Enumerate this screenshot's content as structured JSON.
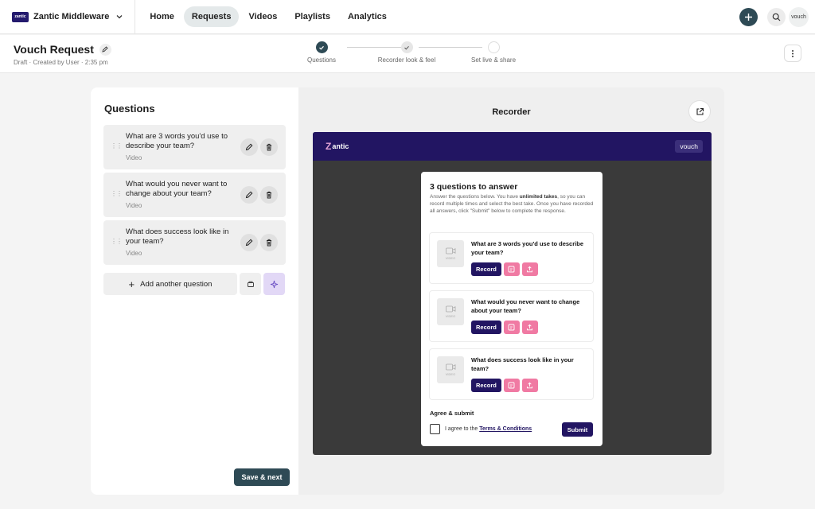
{
  "brand": {
    "logo_text": "zantic",
    "name": "Zantic Middleware"
  },
  "nav": {
    "items": [
      {
        "label": "Home",
        "active": false
      },
      {
        "label": "Requests",
        "active": true
      },
      {
        "label": "Videos",
        "active": false
      },
      {
        "label": "Playlists",
        "active": false
      },
      {
        "label": "Analytics",
        "active": false
      }
    ]
  },
  "topright": {
    "avatar_text": "vouch"
  },
  "header": {
    "title": "Vouch Request",
    "subtitle": "Draft · Created by User · 2:35 pm"
  },
  "stepper": {
    "steps": [
      {
        "label": "Questions",
        "state": "done"
      },
      {
        "label": "Recorder look & feel",
        "state": "checked"
      },
      {
        "label": "Set live & share",
        "state": "pending"
      }
    ]
  },
  "questions": {
    "heading": "Questions",
    "items": [
      {
        "text": "What are 3 words you'd use to describe your team?",
        "type": "Video"
      },
      {
        "text": "What would you never want to change about your team?",
        "type": "Video"
      },
      {
        "text": "What does success look like in your team?",
        "type": "Video"
      }
    ],
    "add_label": "Add another question",
    "save_label": "Save & next"
  },
  "recorder": {
    "title": "Recorder",
    "header_logo_text": "antic",
    "header_badge": "vouch",
    "card_title": "3 questions to answer",
    "desc_1": "Answer the questions below. You have ",
    "desc_bold": "unlimited takes",
    "desc_2": ", so you can record multiple times and select the best take. Once you have recorded all answers, click \"Submit\" below to complete the response.",
    "thumb_label": "VIDEO",
    "record_label": "Record",
    "questions": [
      "What are 3 words you'd use to describe your team?",
      "What would you never want to change about your team?",
      "What does success look like in your team?"
    ],
    "agree_heading": "Agree & submit",
    "agree_text": "I agree to the ",
    "agree_link": "Terms & Conditions",
    "submit_label": "Submit"
  },
  "colors": {
    "accent": "#2e4a55",
    "brand": "#221562",
    "pink": "#f07aa3",
    "ai": "#e2d8f6"
  }
}
